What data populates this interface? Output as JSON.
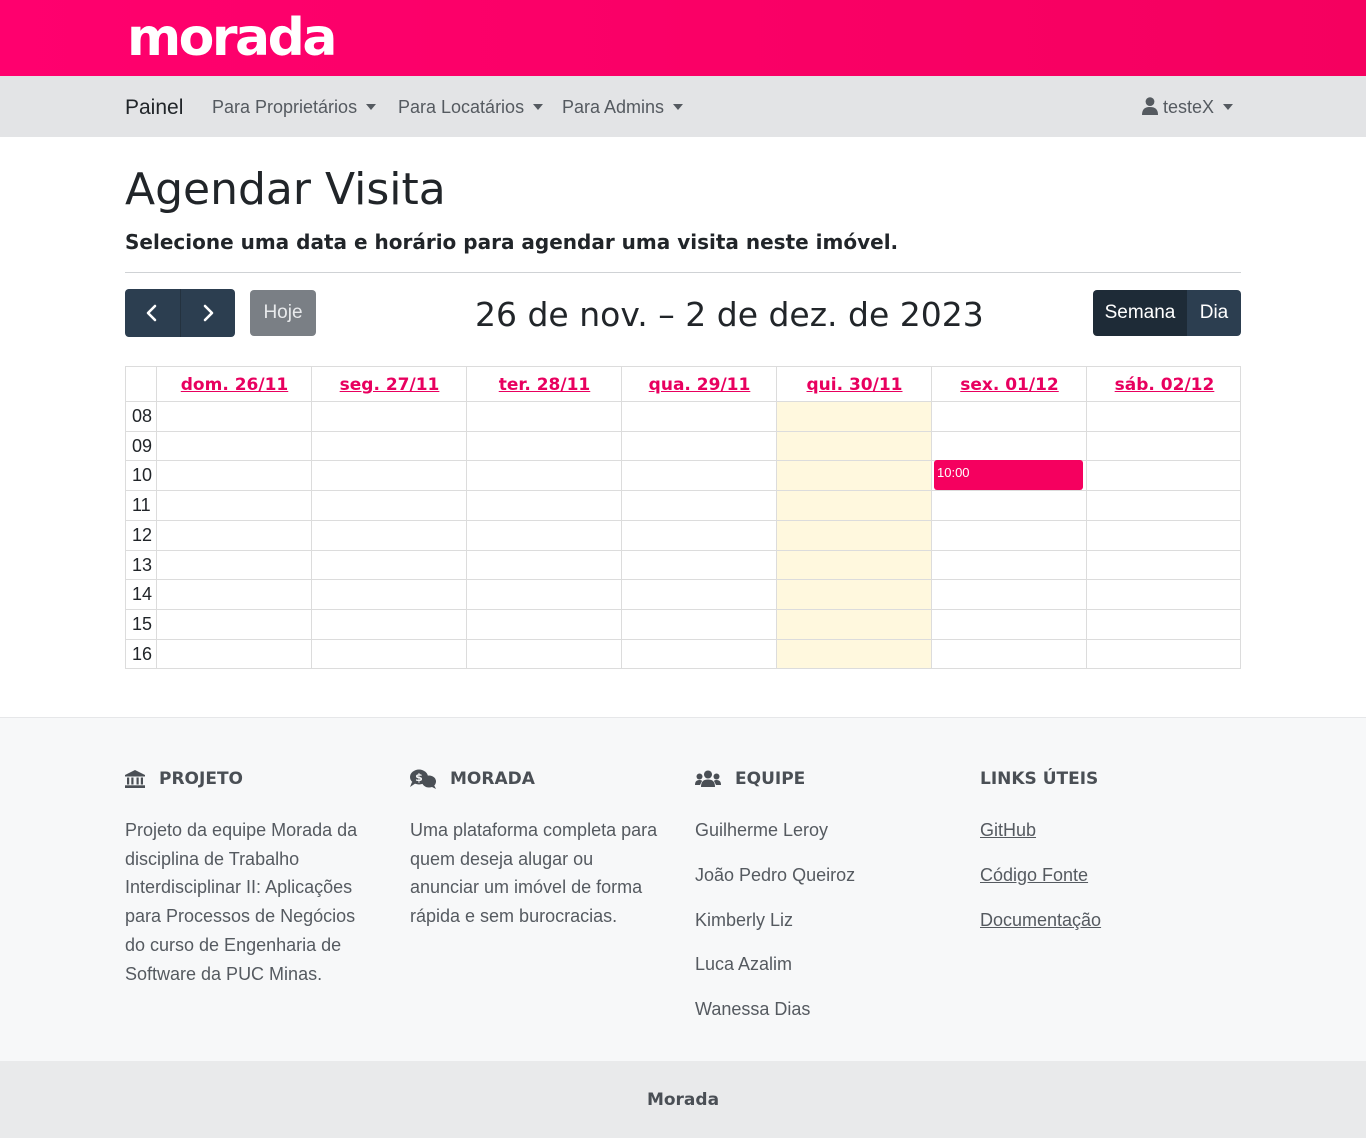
{
  "brand": {
    "logo_text": "morada"
  },
  "navbar": {
    "brand": "Painel",
    "links": [
      {
        "label": "Para Proprietários"
      },
      {
        "label": "Para Locatários"
      },
      {
        "label": "Para Admins"
      }
    ],
    "user": {
      "label": "testeX",
      "icon": "user-icon"
    }
  },
  "page": {
    "title": "Agendar Visita",
    "subtitle": "Selecione uma data e horário para agendar uma visita neste imóvel."
  },
  "calendar": {
    "prev_icon": "chevron-left-icon",
    "next_icon": "chevron-right-icon",
    "today_button": "Hoje",
    "range_title": "26 de nov. – 2 de dez. de 2023",
    "views": [
      {
        "label": "Semana",
        "active": true
      },
      {
        "label": "Dia",
        "active": false
      }
    ],
    "days": [
      "dom. 26/11",
      "seg. 27/11",
      "ter. 28/11",
      "qua. 29/11",
      "qui. 30/11",
      "sex. 01/12",
      "sáb. 02/12"
    ],
    "today_index": 4,
    "hours": [
      "08",
      "09",
      "10",
      "11",
      "12",
      "13",
      "14",
      "15",
      "16"
    ],
    "events": [
      {
        "label": "10:00",
        "day_index": 5,
        "hour": "10"
      }
    ],
    "colors": {
      "accent": "#e8005f",
      "event": "#f5005f",
      "today": "#fff8de"
    }
  },
  "footer": {
    "projeto": {
      "title": "PROJETO",
      "icon": "bank-icon",
      "text": "Projeto da equipe Morada da disciplina de Trabalho Interdisciplinar II: Aplicações para Processos de Negócios do curso de Engenharia de Software da PUC Minas."
    },
    "morada": {
      "title": "MORADA",
      "icon": "money-chat-icon",
      "text": "Uma plataforma completa para quem deseja alugar ou anunciar um imóvel de forma rápida e sem burocracias."
    },
    "equipe": {
      "title": "EQUIPE",
      "icon": "users-icon",
      "members": [
        "Guilherme Leroy",
        "João Pedro Queiroz",
        "Kimberly Liz",
        "Luca Azalim",
        "Wanessa Dias"
      ]
    },
    "links": {
      "title": "LINKS ÚTEIS",
      "items": [
        "GitHub",
        "Código Fonte",
        "Documentação"
      ]
    },
    "bottom": "Morada"
  }
}
